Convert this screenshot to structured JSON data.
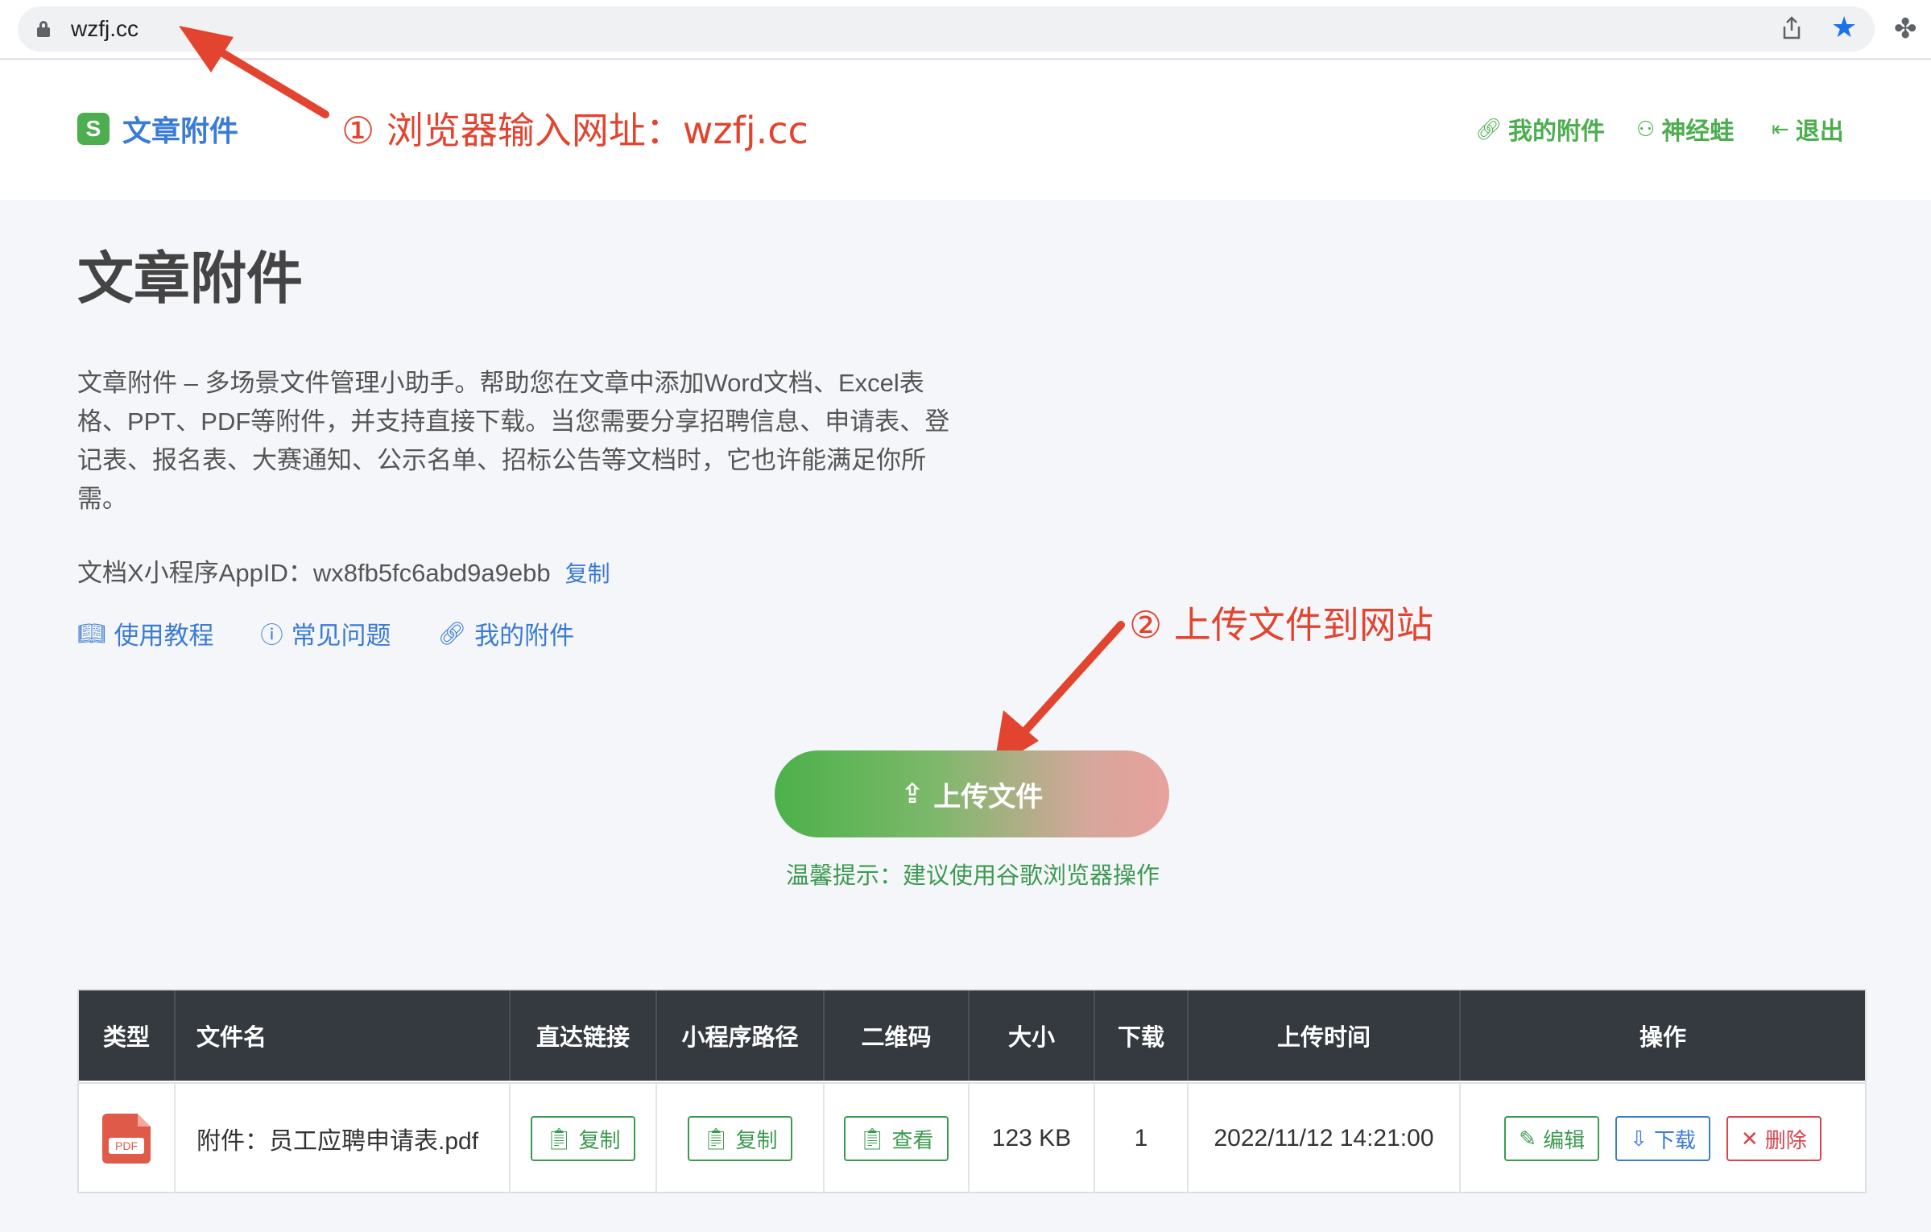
{
  "browser": {
    "url": "wzfj.cc"
  },
  "header": {
    "logo_glyph": "S",
    "logo_text": "文章附件",
    "nav": [
      {
        "label": "我的附件",
        "icon": "link-icon"
      },
      {
        "label": "神经蛙",
        "icon": "user-icon"
      },
      {
        "label": "退出",
        "icon": "logout-icon"
      }
    ]
  },
  "annotations": {
    "step1": "① 浏览器输入网址：wzfj.cc",
    "step2": "② 上传文件到网站"
  },
  "main": {
    "title": "文章附件",
    "description": "文章附件 – 多场景文件管理小助手。帮助您在文章中添加Word文档、Excel表格、PPT、PDF等附件，并支持直接下载。当您需要分享招聘信息、申请表、登记表、报名表、大赛通知、公示名单、招标公告等文档时，它也许能满足你所需。",
    "appid_label": "文档X小程序AppID：wx8fb5fc6abd9a9ebb",
    "appid_copy": "复制",
    "links": [
      {
        "label": "使用教程",
        "icon": "book-icon"
      },
      {
        "label": "常见问题",
        "icon": "question-icon"
      },
      {
        "label": "我的附件",
        "icon": "link-icon"
      }
    ],
    "upload_label": "上传文件",
    "tip": "温馨提示：建议使用谷歌浏览器操作"
  },
  "table": {
    "headers": [
      "类型",
      "文件名",
      "直达链接",
      "小程序路径",
      "二维码",
      "大小",
      "下载",
      "上传时间",
      "操作"
    ],
    "rows": [
      {
        "type_label": "PDF",
        "filename": "附件：员工应聘申请表.pdf",
        "link_btn": "复制",
        "path_btn": "复制",
        "qr_btn": "查看",
        "size": "123 KB",
        "downloads": "1",
        "uploaded": "2022/11/12 14:21:00",
        "edit": "编辑",
        "download": "下载",
        "delete": "删除"
      }
    ]
  },
  "colors": {
    "green": "#4cae4f",
    "blue": "#3a7bd5",
    "red": "#e2442f",
    "header_dark": "#343a40"
  }
}
